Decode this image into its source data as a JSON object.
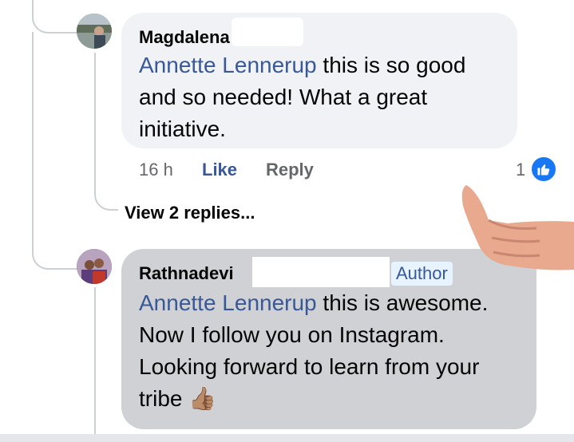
{
  "comment1": {
    "author": "Magdalena",
    "mention": "Annette Lennerup",
    "text_line1_rest": " this is so good",
    "text_line2": "and so needed! What a great",
    "text_line3": "initiative.",
    "time": "16 h",
    "like_label": "Like",
    "reply_label": "Reply",
    "reaction_count": "1",
    "view_replies": "View 2 replies..."
  },
  "comment2": {
    "author": "Rathnadevi",
    "badge": "Author",
    "mention": "Annette Lennerup",
    "text_line1_rest": " this is awesome.",
    "text_line2": "Now I follow you on Instagram.",
    "text_line3": "Looking forward to learn from your",
    "text_line4": "tribe",
    "emoji": "👍🏽"
  },
  "colors": {
    "link": "#385898",
    "like_badge": "#1877f2",
    "bubble": "#f0f2f5",
    "bubble_highlighted": "#cfd1d4"
  },
  "icons": [
    "thumbs-up-reaction-icon",
    "thumbs-up-emoji",
    "thumbs-up-hand-sticker"
  ]
}
